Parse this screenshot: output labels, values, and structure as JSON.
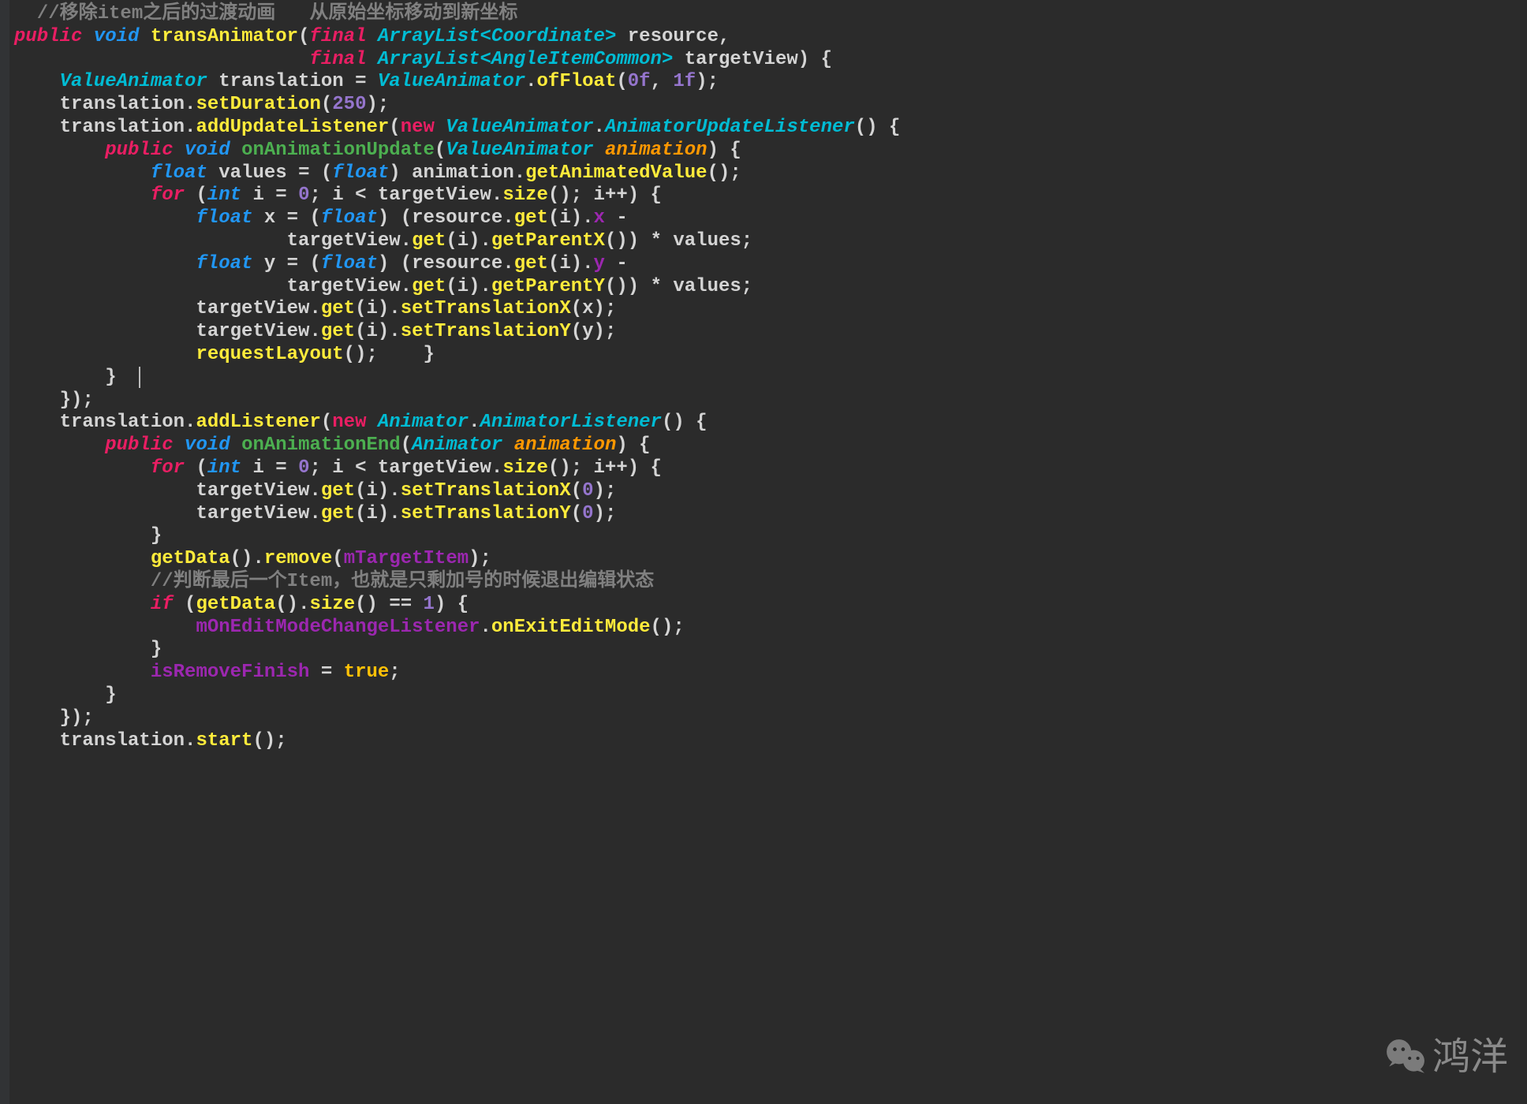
{
  "code": {
    "lines": [
      [
        {
          "cls": "comment",
          "t": "  //移除item之后的过渡动画   从原始坐标移动到新坐标"
        }
      ],
      [
        {
          "cls": "keyword-red",
          "t": "public "
        },
        {
          "cls": "keyword-blue",
          "t": "void "
        },
        {
          "cls": "method-yellow",
          "t": "transAnimator"
        },
        {
          "cls": "identifier",
          "t": "("
        },
        {
          "cls": "keyword-red",
          "t": "final "
        },
        {
          "cls": "type",
          "t": "ArrayList<Coordinate>"
        },
        {
          "cls": "identifier",
          "t": " resource,"
        }
      ],
      [
        {
          "cls": "identifier",
          "t": "                          "
        },
        {
          "cls": "keyword-red",
          "t": "final "
        },
        {
          "cls": "type",
          "t": "ArrayList<AngleItemCommon>"
        },
        {
          "cls": "identifier",
          "t": " targetView) {"
        }
      ],
      [
        {
          "cls": "identifier",
          "t": "    "
        },
        {
          "cls": "type",
          "t": "ValueAnimator"
        },
        {
          "cls": "identifier",
          "t": " translation = "
        },
        {
          "cls": "type",
          "t": "ValueAnimator"
        },
        {
          "cls": "identifier",
          "t": "."
        },
        {
          "cls": "method-yellow",
          "t": "ofFloat"
        },
        {
          "cls": "identifier",
          "t": "("
        },
        {
          "cls": "number",
          "t": "0f"
        },
        {
          "cls": "identifier",
          "t": ", "
        },
        {
          "cls": "number",
          "t": "1f"
        },
        {
          "cls": "identifier",
          "t": ");"
        }
      ],
      [
        {
          "cls": "identifier",
          "t": "    translation."
        },
        {
          "cls": "method-yellow",
          "t": "setDuration"
        },
        {
          "cls": "identifier",
          "t": "("
        },
        {
          "cls": "number",
          "t": "250"
        },
        {
          "cls": "identifier",
          "t": ");"
        }
      ],
      [
        {
          "cls": "identifier",
          "t": "    translation."
        },
        {
          "cls": "method-yellow",
          "t": "addUpdateListener"
        },
        {
          "cls": "identifier",
          "t": "("
        },
        {
          "cls": "new-keyword",
          "t": "new "
        },
        {
          "cls": "type",
          "t": "ValueAnimator"
        },
        {
          "cls": "identifier",
          "t": "."
        },
        {
          "cls": "type",
          "t": "AnimatorUpdateListener"
        },
        {
          "cls": "identifier",
          "t": "() {"
        }
      ],
      [
        {
          "cls": "identifier",
          "t": "        "
        },
        {
          "cls": "keyword-red",
          "t": "public "
        },
        {
          "cls": "keyword-blue",
          "t": "void "
        },
        {
          "cls": "method-green",
          "t": "onAnimationUpdate"
        },
        {
          "cls": "identifier",
          "t": "("
        },
        {
          "cls": "type",
          "t": "ValueAnimator "
        },
        {
          "cls": "param-orange",
          "t": "animation"
        },
        {
          "cls": "identifier",
          "t": ") {"
        }
      ],
      [
        {
          "cls": "identifier",
          "t": "            "
        },
        {
          "cls": "keyword-blue",
          "t": "float "
        },
        {
          "cls": "identifier",
          "t": "values = ("
        },
        {
          "cls": "keyword-blue",
          "t": "float"
        },
        {
          "cls": "identifier",
          "t": ") animation."
        },
        {
          "cls": "method-yellow",
          "t": "getAnimatedValue"
        },
        {
          "cls": "identifier",
          "t": "();"
        }
      ],
      [
        {
          "cls": "identifier",
          "t": "            "
        },
        {
          "cls": "keyword-red",
          "t": "for "
        },
        {
          "cls": "identifier",
          "t": "("
        },
        {
          "cls": "keyword-blue",
          "t": "int "
        },
        {
          "cls": "identifier",
          "t": "i = "
        },
        {
          "cls": "number",
          "t": "0"
        },
        {
          "cls": "identifier",
          "t": "; i < targetView."
        },
        {
          "cls": "method-yellow",
          "t": "size"
        },
        {
          "cls": "identifier",
          "t": "(); i++) {"
        }
      ],
      [
        {
          "cls": "identifier",
          "t": "                "
        },
        {
          "cls": "keyword-blue",
          "t": "float "
        },
        {
          "cls": "identifier",
          "t": "x = ("
        },
        {
          "cls": "keyword-blue",
          "t": "float"
        },
        {
          "cls": "identifier",
          "t": ") (resource."
        },
        {
          "cls": "method-yellow",
          "t": "get"
        },
        {
          "cls": "identifier",
          "t": "(i)."
        },
        {
          "cls": "field",
          "t": "x"
        },
        {
          "cls": "identifier",
          "t": " -"
        }
      ],
      [
        {
          "cls": "identifier",
          "t": "                        targetView."
        },
        {
          "cls": "method-yellow",
          "t": "get"
        },
        {
          "cls": "identifier",
          "t": "(i)."
        },
        {
          "cls": "method-yellow",
          "t": "getParentX"
        },
        {
          "cls": "identifier",
          "t": "()) * values;"
        }
      ],
      [
        {
          "cls": "identifier",
          "t": "                "
        },
        {
          "cls": "keyword-blue",
          "t": "float "
        },
        {
          "cls": "identifier",
          "t": "y = ("
        },
        {
          "cls": "keyword-blue",
          "t": "float"
        },
        {
          "cls": "identifier",
          "t": ") (resource."
        },
        {
          "cls": "method-yellow",
          "t": "get"
        },
        {
          "cls": "identifier",
          "t": "(i)."
        },
        {
          "cls": "field",
          "t": "y"
        },
        {
          "cls": "identifier",
          "t": " -"
        }
      ],
      [
        {
          "cls": "identifier",
          "t": "                        targetView."
        },
        {
          "cls": "method-yellow",
          "t": "get"
        },
        {
          "cls": "identifier",
          "t": "(i)."
        },
        {
          "cls": "method-yellow",
          "t": "getParentY"
        },
        {
          "cls": "identifier",
          "t": "()) * values;"
        }
      ],
      [
        {
          "cls": "identifier",
          "t": "                targetView."
        },
        {
          "cls": "method-yellow",
          "t": "get"
        },
        {
          "cls": "identifier",
          "t": "(i)."
        },
        {
          "cls": "method-yellow",
          "t": "setTranslationX"
        },
        {
          "cls": "identifier",
          "t": "(x);"
        }
      ],
      [
        {
          "cls": "identifier",
          "t": "                targetView."
        },
        {
          "cls": "method-yellow",
          "t": "get"
        },
        {
          "cls": "identifier",
          "t": "(i)."
        },
        {
          "cls": "method-yellow",
          "t": "setTranslationY"
        },
        {
          "cls": "identifier",
          "t": "(y);"
        }
      ],
      [
        {
          "cls": "identifier",
          "t": "                "
        },
        {
          "cls": "method-yellow",
          "t": "requestLayout"
        },
        {
          "cls": "identifier",
          "t": "();    }"
        }
      ],
      [
        {
          "cls": "identifier",
          "t": "        }  "
        },
        {
          "cls": "cursor-marker",
          "t": ""
        }
      ],
      [
        {
          "cls": "identifier",
          "t": "    });"
        }
      ],
      [
        {
          "cls": "identifier",
          "t": "    translation."
        },
        {
          "cls": "method-yellow",
          "t": "addListener"
        },
        {
          "cls": "identifier",
          "t": "("
        },
        {
          "cls": "new-keyword",
          "t": "new "
        },
        {
          "cls": "type",
          "t": "Animator"
        },
        {
          "cls": "identifier",
          "t": "."
        },
        {
          "cls": "type",
          "t": "AnimatorListener"
        },
        {
          "cls": "identifier",
          "t": "() {"
        }
      ],
      [
        {
          "cls": "identifier",
          "t": "        "
        },
        {
          "cls": "keyword-red",
          "t": "public "
        },
        {
          "cls": "keyword-blue",
          "t": "void "
        },
        {
          "cls": "method-green",
          "t": "onAnimationEnd"
        },
        {
          "cls": "identifier",
          "t": "("
        },
        {
          "cls": "type",
          "t": "Animator "
        },
        {
          "cls": "param-orange",
          "t": "animation"
        },
        {
          "cls": "identifier",
          "t": ") {"
        }
      ],
      [
        {
          "cls": "identifier",
          "t": "            "
        },
        {
          "cls": "keyword-red",
          "t": "for "
        },
        {
          "cls": "identifier",
          "t": "("
        },
        {
          "cls": "keyword-blue",
          "t": "int "
        },
        {
          "cls": "identifier",
          "t": "i = "
        },
        {
          "cls": "number",
          "t": "0"
        },
        {
          "cls": "identifier",
          "t": "; i < targetView."
        },
        {
          "cls": "method-yellow",
          "t": "size"
        },
        {
          "cls": "identifier",
          "t": "(); i++) {"
        }
      ],
      [
        {
          "cls": "identifier",
          "t": "                targetView."
        },
        {
          "cls": "method-yellow",
          "t": "get"
        },
        {
          "cls": "identifier",
          "t": "(i)."
        },
        {
          "cls": "method-yellow",
          "t": "setTranslationX"
        },
        {
          "cls": "identifier",
          "t": "("
        },
        {
          "cls": "number",
          "t": "0"
        },
        {
          "cls": "identifier",
          "t": ");"
        }
      ],
      [
        {
          "cls": "identifier",
          "t": "                targetView."
        },
        {
          "cls": "method-yellow",
          "t": "get"
        },
        {
          "cls": "identifier",
          "t": "(i)."
        },
        {
          "cls": "method-yellow",
          "t": "setTranslationY"
        },
        {
          "cls": "identifier",
          "t": "("
        },
        {
          "cls": "number",
          "t": "0"
        },
        {
          "cls": "identifier",
          "t": ");"
        }
      ],
      [
        {
          "cls": "identifier",
          "t": "            }"
        }
      ],
      [
        {
          "cls": "identifier",
          "t": "            "
        },
        {
          "cls": "method-yellow",
          "t": "getData"
        },
        {
          "cls": "identifier",
          "t": "()."
        },
        {
          "cls": "method-yellow",
          "t": "remove"
        },
        {
          "cls": "identifier",
          "t": "("
        },
        {
          "cls": "field",
          "t": "mTargetItem"
        },
        {
          "cls": "identifier",
          "t": ");"
        }
      ],
      [
        {
          "cls": "identifier",
          "t": "            "
        },
        {
          "cls": "comment",
          "t": "//判断最后一个Item，也就是只剩加号的时候退出编辑状态"
        }
      ],
      [
        {
          "cls": "identifier",
          "t": "            "
        },
        {
          "cls": "keyword-red",
          "t": "if "
        },
        {
          "cls": "identifier",
          "t": "("
        },
        {
          "cls": "method-yellow",
          "t": "getData"
        },
        {
          "cls": "identifier",
          "t": "()."
        },
        {
          "cls": "method-yellow",
          "t": "size"
        },
        {
          "cls": "identifier",
          "t": "() == "
        },
        {
          "cls": "number",
          "t": "1"
        },
        {
          "cls": "identifier",
          "t": ") {"
        }
      ],
      [
        {
          "cls": "identifier",
          "t": "                "
        },
        {
          "cls": "field",
          "t": "mOnEditModeChangeListener"
        },
        {
          "cls": "identifier",
          "t": "."
        },
        {
          "cls": "method-yellow",
          "t": "onExitEditMode"
        },
        {
          "cls": "identifier",
          "t": "();"
        }
      ],
      [
        {
          "cls": "identifier",
          "t": "            }"
        }
      ],
      [
        {
          "cls": "identifier",
          "t": "            "
        },
        {
          "cls": "field",
          "t": "isRemoveFinish"
        },
        {
          "cls": "identifier",
          "t": " = "
        },
        {
          "cls": "bool",
          "t": "true"
        },
        {
          "cls": "identifier",
          "t": ";"
        }
      ],
      [
        {
          "cls": "identifier",
          "t": "        }"
        }
      ],
      [
        {
          "cls": "identifier",
          "t": "    });"
        }
      ],
      [
        {
          "cls": "identifier",
          "t": "    translation."
        },
        {
          "cls": "method-yellow",
          "t": "start"
        },
        {
          "cls": "identifier",
          "t": "();"
        }
      ]
    ]
  },
  "watermark": {
    "text": "鸿洋"
  }
}
